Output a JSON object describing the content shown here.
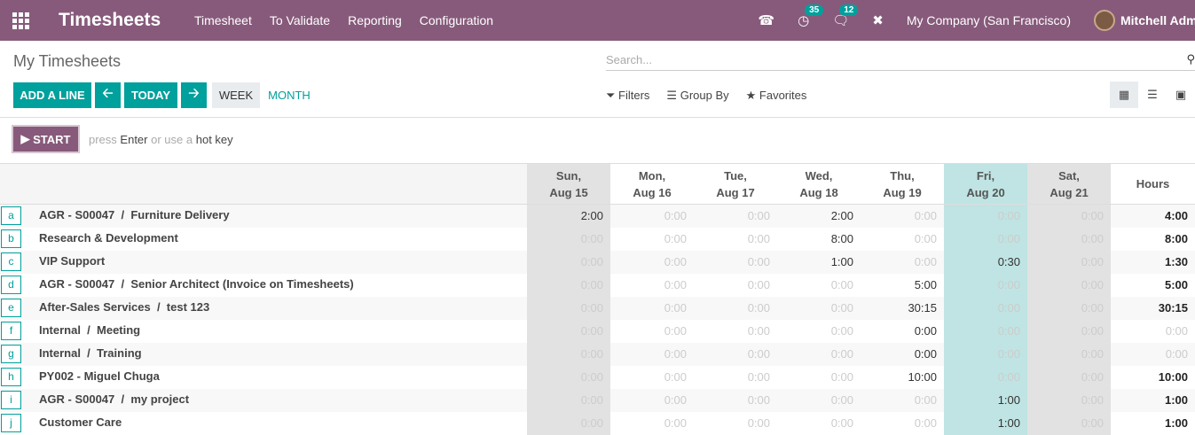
{
  "navbar": {
    "app_title": "Timesheets",
    "menu": [
      "Timesheet",
      "To Validate",
      "Reporting",
      "Configuration"
    ],
    "activity_badge": "35",
    "messages_badge": "12",
    "company": "My Company (San Francisco)",
    "user": "Mitchell Admin"
  },
  "control": {
    "title": "My Timesheets",
    "search_placeholder": "Search...",
    "add_line": "ADD A LINE",
    "today": "TODAY",
    "week": "WEEK",
    "month": "MONTH",
    "filters": "Filters",
    "group_by": "Group By",
    "favorites": "Favorites"
  },
  "timer": {
    "start": "START",
    "hint_press": "press",
    "hint_enter": "Enter",
    "hint_or": "or use a",
    "hint_hotkey": "hot key"
  },
  "grid": {
    "days": [
      {
        "day": "Sun,",
        "date": "Aug 15",
        "kind": "weekend"
      },
      {
        "day": "Mon,",
        "date": "Aug 16",
        "kind": "normal"
      },
      {
        "day": "Tue,",
        "date": "Aug 17",
        "kind": "normal"
      },
      {
        "day": "Wed,",
        "date": "Aug 18",
        "kind": "normal"
      },
      {
        "day": "Thu,",
        "date": "Aug 19",
        "kind": "normal"
      },
      {
        "day": "Fri,",
        "date": "Aug 20",
        "kind": "today"
      },
      {
        "day": "Sat,",
        "date": "Aug 21",
        "kind": "weekend"
      }
    ],
    "hours_label": "Hours",
    "rows": [
      {
        "key": "a",
        "name": "AGR - S00047  /  Furniture Delivery",
        "values": [
          "2:00",
          "0:00",
          "0:00",
          "2:00",
          "0:00",
          "0:00",
          "0:00"
        ],
        "total": "4:00"
      },
      {
        "key": "b",
        "name": "Research & Development",
        "values": [
          "0:00",
          "0:00",
          "0:00",
          "8:00",
          "0:00",
          "0:00",
          "0:00"
        ],
        "total": "8:00"
      },
      {
        "key": "c",
        "name": "VIP Support",
        "values": [
          "0:00",
          "0:00",
          "0:00",
          "1:00",
          "0:00",
          "0:30",
          "0:00"
        ],
        "total": "1:30"
      },
      {
        "key": "d",
        "name": "AGR - S00047  /  Senior Architect (Invoice on Timesheets)",
        "values": [
          "0:00",
          "0:00",
          "0:00",
          "0:00",
          "5:00",
          "0:00",
          "0:00"
        ],
        "total": "5:00"
      },
      {
        "key": "e",
        "name": "After-Sales Services  /  test 123",
        "values": [
          "0:00",
          "0:00",
          "0:00",
          "0:00",
          "30:15",
          "0:00",
          "0:00"
        ],
        "total": "30:15"
      },
      {
        "key": "f",
        "name": "Internal  /  Meeting",
        "values": [
          "0:00",
          "0:00",
          "0:00",
          "0:00",
          "0:00",
          "0:00",
          "0:00"
        ],
        "total": "0:00"
      },
      {
        "key": "g",
        "name": "Internal  /  Training",
        "values": [
          "0:00",
          "0:00",
          "0:00",
          "0:00",
          "0:00",
          "0:00",
          "0:00"
        ],
        "total": "0:00"
      },
      {
        "key": "h",
        "name": "PY002 - Miguel Chuga",
        "values": [
          "0:00",
          "0:00",
          "0:00",
          "0:00",
          "10:00",
          "0:00",
          "0:00"
        ],
        "total": "10:00"
      },
      {
        "key": "i",
        "name": "AGR - S00047  /  my project",
        "values": [
          "0:00",
          "0:00",
          "0:00",
          "0:00",
          "0:00",
          "1:00",
          "0:00"
        ],
        "total": "1:00"
      },
      {
        "key": "j",
        "name": "Customer Care",
        "values": [
          "0:00",
          "0:00",
          "0:00",
          "0:00",
          "0:00",
          "1:00",
          "0:00"
        ],
        "total": "1:00"
      }
    ],
    "nonzero": [
      [
        "2:00",
        null,
        null,
        "2:00",
        null,
        null,
        null
      ],
      [
        null,
        null,
        null,
        "8:00",
        null,
        null,
        null
      ],
      [
        null,
        null,
        null,
        "1:00",
        null,
        "0:30",
        null
      ],
      [
        null,
        null,
        null,
        null,
        "5:00",
        null,
        null
      ],
      [
        null,
        null,
        null,
        null,
        "30:15",
        null,
        null
      ],
      [
        null,
        null,
        null,
        null,
        "0:00",
        null,
        null
      ],
      [
        null,
        null,
        null,
        null,
        "0:00",
        null,
        null
      ],
      [
        null,
        null,
        null,
        null,
        "10:00",
        null,
        null
      ],
      [
        null,
        null,
        null,
        null,
        null,
        "1:00",
        null
      ],
      [
        null,
        null,
        null,
        null,
        null,
        "1:00",
        null
      ]
    ]
  }
}
